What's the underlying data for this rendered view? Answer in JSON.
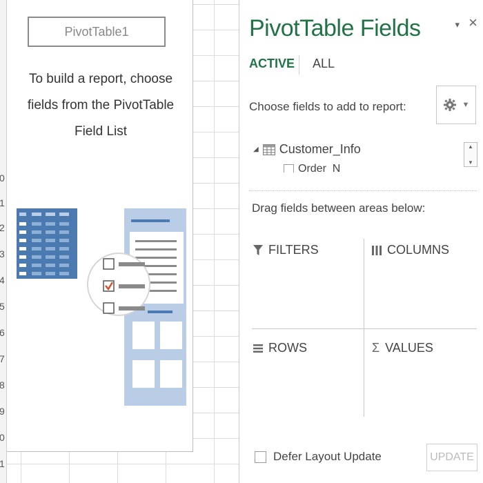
{
  "spreadsheet": {
    "row_numbers": [
      "0",
      "1",
      "2",
      "3",
      "4",
      "5",
      "6",
      "7",
      "8",
      "9",
      "0",
      "1"
    ]
  },
  "pivot_placeholder": {
    "name": "PivotTable1",
    "instructions": "To build a report, choose fields from the PivotTable Field List"
  },
  "field_pane": {
    "title": "PivotTable Fields",
    "options_glyph": "▾",
    "close_glyph": "×",
    "tabs": [
      {
        "label": "ACTIVE",
        "selected": true
      },
      {
        "label": "ALL",
        "selected": false
      }
    ],
    "choose_label": "Choose fields to add to report:",
    "tools_icon": "gear-icon",
    "field_list": {
      "table_name": "Customer_Info",
      "partial_field": "Order_N"
    },
    "drag_label": "Drag fields between areas below:",
    "areas": {
      "filters": "FILTERS",
      "columns": "COLUMNS",
      "rows": "ROWS",
      "values": "VALUES"
    },
    "defer_label": "Defer Layout Update",
    "defer_checked": false,
    "update_label": "UPDATE",
    "colors": {
      "accent_green": "#217346",
      "illustration_blue": "#4a7ab0",
      "illustration_light": "#b9cde6"
    }
  }
}
